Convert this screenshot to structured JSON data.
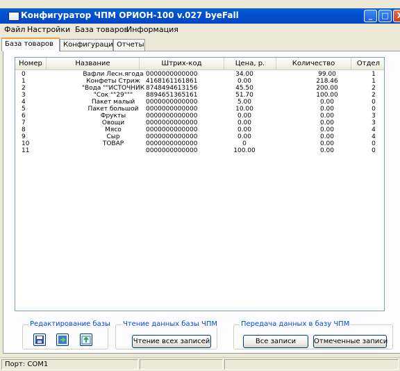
{
  "window": {
    "title": "Конфигуратор ЧПМ ОРИОН-100 v.027 byeFall",
    "minimize_label": "_",
    "maximize_label": "□",
    "close_label": "X"
  },
  "menu": {
    "items": [
      {
        "label": "Файл"
      },
      {
        "label": "Настройки"
      },
      {
        "label": "База товаров"
      },
      {
        "label": "Информация"
      }
    ]
  },
  "tabs": [
    {
      "label": "База товаров",
      "active": true
    },
    {
      "label": "Конфигурация",
      "active": false
    },
    {
      "label": "Отчеты",
      "active": false
    }
  ],
  "table": {
    "columns": [
      "Номер",
      "Название",
      "Штрих-код",
      "Цена, р.",
      "Количество",
      "Отдел"
    ],
    "rows": [
      [
        "0",
        "Вафли Лесн.ягода",
        "0000000000000",
        "34.00",
        "99.00",
        "1"
      ],
      [
        "1",
        "Конфеты Стриж",
        "4168161161861",
        "0.00",
        "218.46",
        "1"
      ],
      [
        "2",
        "\"Вода \"\"ИСТОЧНИК",
        "8748494613156",
        "45.50",
        "200.00",
        "2"
      ],
      [
        "3",
        "\"Сок \"\"29\"\"\"",
        "8894651365161",
        "51.70",
        "100.00",
        "2"
      ],
      [
        "4",
        "Пакет малый",
        "0000000000000",
        "5.00",
        "0.00",
        "0"
      ],
      [
        "5",
        "Пакет большой",
        "0000000000000",
        "10.00",
        "0.00",
        "0"
      ],
      [
        "6",
        "Фрукты",
        "0000000000000",
        "0.00",
        "0.00",
        "3"
      ],
      [
        "7",
        "Овощи",
        "0000000000000",
        "0.00",
        "0.00",
        "3"
      ],
      [
        "8",
        "Мясо",
        "0000000000000",
        "0.00",
        "0.00",
        "4"
      ],
      [
        "9",
        "Сыр",
        "0000000000000",
        "0.00",
        "0.00",
        "4"
      ],
      [
        "10",
        "ТОВАР",
        "0000000000000",
        "0",
        "0.00",
        "0"
      ],
      [
        "11",
        "",
        "0000000000000",
        "100.00",
        "0.00",
        "0"
      ]
    ]
  },
  "groups": {
    "edit": {
      "title": "Редактирование базы",
      "icons": [
        "save-icon",
        "import-icon",
        "export-icon"
      ]
    },
    "read": {
      "title": "Чтение данных базы ЧПМ",
      "button": "Чтение всех записей"
    },
    "send": {
      "title": "Передача данных в базу ЧПМ",
      "button_all": "Все записи",
      "button_marked": "Отмеченные записи"
    }
  },
  "statusbar": {
    "port": "Порт: COM1"
  },
  "colors": {
    "titlebar": "#0350d0",
    "group_title": "#0046d5",
    "active_tab_accent": "#f7a034"
  }
}
